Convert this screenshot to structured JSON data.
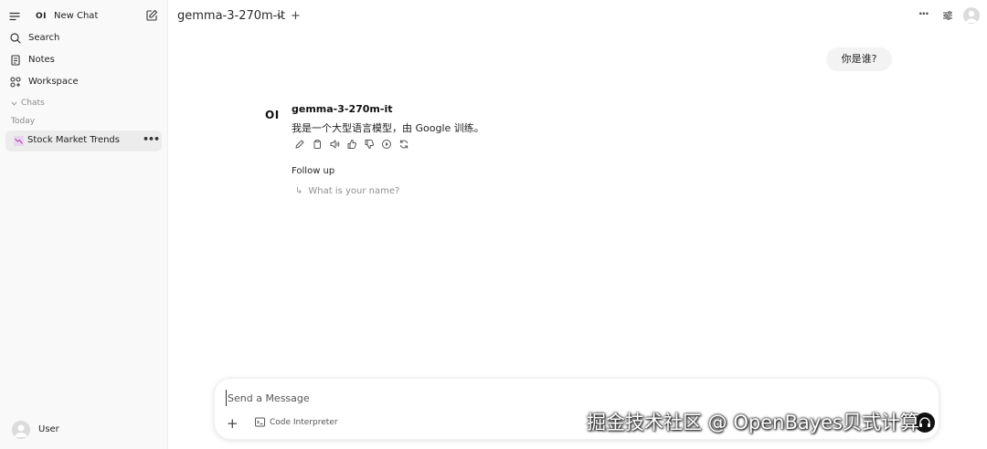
{
  "sidebar": {
    "new_chat_logo": "OI",
    "new_chat_label": "New Chat",
    "nav": [
      {
        "label": "Search",
        "icon": "search-icon"
      },
      {
        "label": "Notes",
        "icon": "notes-icon"
      },
      {
        "label": "Workspace",
        "icon": "workspace-icon"
      }
    ],
    "chats_label": "Chats",
    "today_label": "Today",
    "chat_items": [
      {
        "label": "Stock Market Trends",
        "icon": "chart-icon"
      }
    ],
    "user_label": "User"
  },
  "header": {
    "model_name": "gemma-3-270m-it",
    "add_model": "+",
    "more": "···"
  },
  "conversation": {
    "user_message": "你是谁?",
    "assistant_logo": "OI",
    "assistant_name": "gemma-3-270m-it",
    "assistant_message": "我是一个大型语言模型，由 Google 训练。",
    "actions": [
      "edit-icon",
      "copy-icon",
      "read-aloud-icon",
      "thumbs-up-icon",
      "thumbs-down-icon",
      "continue-icon",
      "regenerate-icon"
    ],
    "followup_title": "Follow up",
    "followups": [
      "What is your name?"
    ]
  },
  "composer": {
    "placeholder": "Send a Message",
    "plus": "+",
    "code_interpreter_label": "Code Interpreter"
  },
  "watermark": "掘金技术社区 @ OpenBayes贝式计算"
}
